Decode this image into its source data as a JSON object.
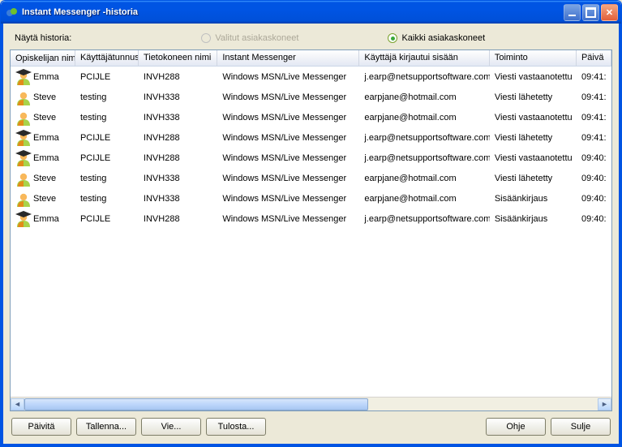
{
  "title": "Instant Messenger -historia",
  "filter": {
    "label": "Näytä historia:",
    "opt_selected": "Valitut asiakaskoneet",
    "opt_all": "Kaikki asiakaskoneet"
  },
  "columns": {
    "c0": "Opiskelijan nimi",
    "c1": "Käyttäjätunnus",
    "c2": "Tietokoneen nimi",
    "c3": "Instant Messenger",
    "c4": "Käyttäjä kirjautui sisään",
    "c5": "Toiminto",
    "c6": "Päivä"
  },
  "rows": [
    {
      "icon": "a",
      "name": "Emma",
      "user": "PCIJLE",
      "pc": "INVH288",
      "im": "Windows MSN/Live Messenger",
      "login": "j.earp@netsupportsoftware.com",
      "action": "Viesti vastaanotettu",
      "time": "09:41:"
    },
    {
      "icon": "b",
      "name": "Steve",
      "user": "testing",
      "pc": "INVH338",
      "im": "Windows MSN/Live Messenger",
      "login": "earpjane@hotmail.com",
      "action": "Viesti lähetetty",
      "time": "09:41:"
    },
    {
      "icon": "b",
      "name": "Steve",
      "user": "testing",
      "pc": "INVH338",
      "im": "Windows MSN/Live Messenger",
      "login": "earpjane@hotmail.com",
      "action": "Viesti vastaanotettu",
      "time": "09:41:"
    },
    {
      "icon": "a",
      "name": "Emma",
      "user": "PCIJLE",
      "pc": "INVH288",
      "im": "Windows MSN/Live Messenger",
      "login": "j.earp@netsupportsoftware.com",
      "action": "Viesti lähetetty",
      "time": "09:41:"
    },
    {
      "icon": "a",
      "name": "Emma",
      "user": "PCIJLE",
      "pc": "INVH288",
      "im": "Windows MSN/Live Messenger",
      "login": "j.earp@netsupportsoftware.com",
      "action": "Viesti vastaanotettu",
      "time": "09:40:"
    },
    {
      "icon": "b",
      "name": "Steve",
      "user": "testing",
      "pc": "INVH338",
      "im": "Windows MSN/Live Messenger",
      "login": "earpjane@hotmail.com",
      "action": "Viesti lähetetty",
      "time": "09:40:"
    },
    {
      "icon": "b",
      "name": "Steve",
      "user": "testing",
      "pc": "INVH338",
      "im": "Windows MSN/Live Messenger",
      "login": "earpjane@hotmail.com",
      "action": "Sisäänkirjaus",
      "time": "09:40:"
    },
    {
      "icon": "a",
      "name": "Emma",
      "user": "PCIJLE",
      "pc": "INVH288",
      "im": "Windows MSN/Live Messenger",
      "login": "j.earp@netsupportsoftware.com",
      "action": "Sisäänkirjaus",
      "time": "09:40:"
    }
  ],
  "buttons": {
    "refresh": "Päivitä",
    "save": "Tallenna...",
    "export": "Vie...",
    "print": "Tulosta...",
    "help": "Ohje",
    "close": "Sulje"
  }
}
